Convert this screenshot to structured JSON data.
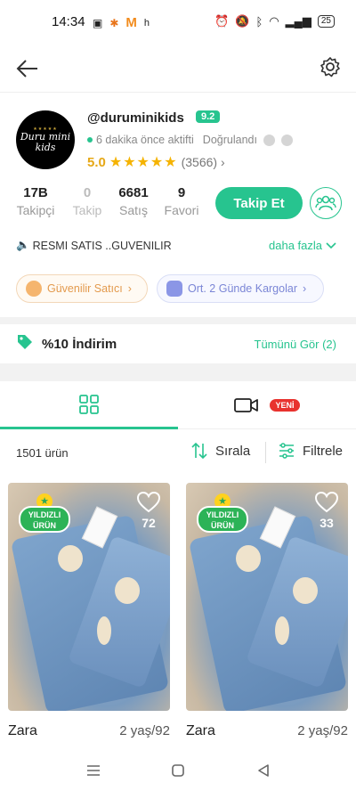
{
  "status_bar": {
    "time": "14:34",
    "battery": "25"
  },
  "profile": {
    "username": "@duruminikids",
    "avatar_text": "Duru mini kids",
    "score": "9.2",
    "active": "6 dakika önce aktifti",
    "verified": "Doğrulandı",
    "rating": "5.0",
    "stars": "★★★★★",
    "rating_count": "(3566)",
    "stats": [
      {
        "num": "17B",
        "label": "Takipçi"
      },
      {
        "num": "0",
        "label": "Takip"
      },
      {
        "num": "6681",
        "label": "Satış"
      },
      {
        "num": "9",
        "label": "Favori"
      }
    ],
    "follow_label": "Takip Et",
    "description": "RESMI SATIS ..GUVENILIR",
    "more_label": "daha fazla",
    "chip_trust": "Güvenilir Satıcı",
    "chip_ship": "Ort. 2 Günde Kargolar"
  },
  "discount": {
    "label": "%10 İndirim",
    "see_all": "Tümünü Gör (2)"
  },
  "tabs": {
    "new_badge": "YENİ"
  },
  "toolbar": {
    "count": "1501 ürün",
    "sort": "Sırala",
    "filter": "Filtrele"
  },
  "products": [
    {
      "badge_line1": "YILDIZLI",
      "badge_line2": "ÜRÜN",
      "favorites": "72",
      "brand": "Zara",
      "size": "2 yaş/92"
    },
    {
      "badge_line1": "YILDIZLI",
      "badge_line2": "ÜRÜN",
      "favorites": "33",
      "brand": "Zara",
      "size": "2 yaş/92"
    }
  ],
  "colors": {
    "accent": "#27c48f",
    "star": "#f5b301",
    "new_badge": "#e8322e"
  }
}
